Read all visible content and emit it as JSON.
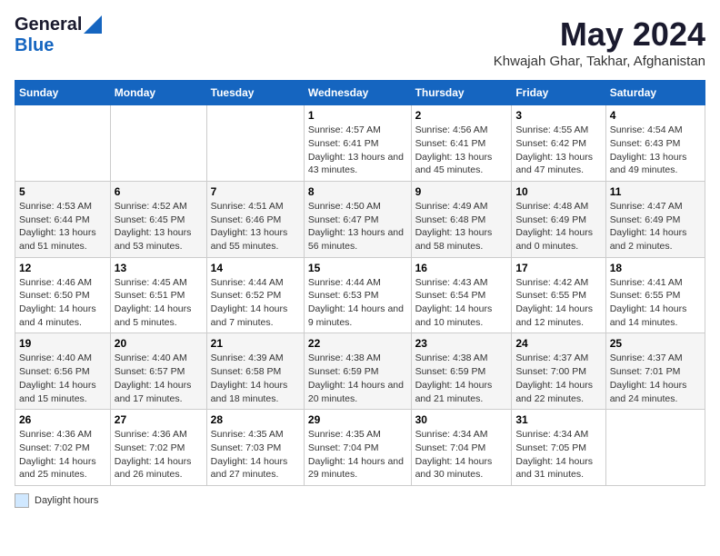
{
  "logo": {
    "general": "General",
    "blue": "Blue"
  },
  "title": "May 2024",
  "subtitle": "Khwajah Ghar, Takhar, Afghanistan",
  "headers": [
    "Sunday",
    "Monday",
    "Tuesday",
    "Wednesday",
    "Thursday",
    "Friday",
    "Saturday"
  ],
  "weeks": [
    [
      {
        "day": "",
        "sunrise": "",
        "sunset": "",
        "daylight": ""
      },
      {
        "day": "",
        "sunrise": "",
        "sunset": "",
        "daylight": ""
      },
      {
        "day": "",
        "sunrise": "",
        "sunset": "",
        "daylight": ""
      },
      {
        "day": "1",
        "sunrise": "Sunrise: 4:57 AM",
        "sunset": "Sunset: 6:41 PM",
        "daylight": "Daylight: 13 hours and 43 minutes."
      },
      {
        "day": "2",
        "sunrise": "Sunrise: 4:56 AM",
        "sunset": "Sunset: 6:41 PM",
        "daylight": "Daylight: 13 hours and 45 minutes."
      },
      {
        "day": "3",
        "sunrise": "Sunrise: 4:55 AM",
        "sunset": "Sunset: 6:42 PM",
        "daylight": "Daylight: 13 hours and 47 minutes."
      },
      {
        "day": "4",
        "sunrise": "Sunrise: 4:54 AM",
        "sunset": "Sunset: 6:43 PM",
        "daylight": "Daylight: 13 hours and 49 minutes."
      }
    ],
    [
      {
        "day": "5",
        "sunrise": "Sunrise: 4:53 AM",
        "sunset": "Sunset: 6:44 PM",
        "daylight": "Daylight: 13 hours and 51 minutes."
      },
      {
        "day": "6",
        "sunrise": "Sunrise: 4:52 AM",
        "sunset": "Sunset: 6:45 PM",
        "daylight": "Daylight: 13 hours and 53 minutes."
      },
      {
        "day": "7",
        "sunrise": "Sunrise: 4:51 AM",
        "sunset": "Sunset: 6:46 PM",
        "daylight": "Daylight: 13 hours and 55 minutes."
      },
      {
        "day": "8",
        "sunrise": "Sunrise: 4:50 AM",
        "sunset": "Sunset: 6:47 PM",
        "daylight": "Daylight: 13 hours and 56 minutes."
      },
      {
        "day": "9",
        "sunrise": "Sunrise: 4:49 AM",
        "sunset": "Sunset: 6:48 PM",
        "daylight": "Daylight: 13 hours and 58 minutes."
      },
      {
        "day": "10",
        "sunrise": "Sunrise: 4:48 AM",
        "sunset": "Sunset: 6:49 PM",
        "daylight": "Daylight: 14 hours and 0 minutes."
      },
      {
        "day": "11",
        "sunrise": "Sunrise: 4:47 AM",
        "sunset": "Sunset: 6:49 PM",
        "daylight": "Daylight: 14 hours and 2 minutes."
      }
    ],
    [
      {
        "day": "12",
        "sunrise": "Sunrise: 4:46 AM",
        "sunset": "Sunset: 6:50 PM",
        "daylight": "Daylight: 14 hours and 4 minutes."
      },
      {
        "day": "13",
        "sunrise": "Sunrise: 4:45 AM",
        "sunset": "Sunset: 6:51 PM",
        "daylight": "Daylight: 14 hours and 5 minutes."
      },
      {
        "day": "14",
        "sunrise": "Sunrise: 4:44 AM",
        "sunset": "Sunset: 6:52 PM",
        "daylight": "Daylight: 14 hours and 7 minutes."
      },
      {
        "day": "15",
        "sunrise": "Sunrise: 4:44 AM",
        "sunset": "Sunset: 6:53 PM",
        "daylight": "Daylight: 14 hours and 9 minutes."
      },
      {
        "day": "16",
        "sunrise": "Sunrise: 4:43 AM",
        "sunset": "Sunset: 6:54 PM",
        "daylight": "Daylight: 14 hours and 10 minutes."
      },
      {
        "day": "17",
        "sunrise": "Sunrise: 4:42 AM",
        "sunset": "Sunset: 6:55 PM",
        "daylight": "Daylight: 14 hours and 12 minutes."
      },
      {
        "day": "18",
        "sunrise": "Sunrise: 4:41 AM",
        "sunset": "Sunset: 6:55 PM",
        "daylight": "Daylight: 14 hours and 14 minutes."
      }
    ],
    [
      {
        "day": "19",
        "sunrise": "Sunrise: 4:40 AM",
        "sunset": "Sunset: 6:56 PM",
        "daylight": "Daylight: 14 hours and 15 minutes."
      },
      {
        "day": "20",
        "sunrise": "Sunrise: 4:40 AM",
        "sunset": "Sunset: 6:57 PM",
        "daylight": "Daylight: 14 hours and 17 minutes."
      },
      {
        "day": "21",
        "sunrise": "Sunrise: 4:39 AM",
        "sunset": "Sunset: 6:58 PM",
        "daylight": "Daylight: 14 hours and 18 minutes."
      },
      {
        "day": "22",
        "sunrise": "Sunrise: 4:38 AM",
        "sunset": "Sunset: 6:59 PM",
        "daylight": "Daylight: 14 hours and 20 minutes."
      },
      {
        "day": "23",
        "sunrise": "Sunrise: 4:38 AM",
        "sunset": "Sunset: 6:59 PM",
        "daylight": "Daylight: 14 hours and 21 minutes."
      },
      {
        "day": "24",
        "sunrise": "Sunrise: 4:37 AM",
        "sunset": "Sunset: 7:00 PM",
        "daylight": "Daylight: 14 hours and 22 minutes."
      },
      {
        "day": "25",
        "sunrise": "Sunrise: 4:37 AM",
        "sunset": "Sunset: 7:01 PM",
        "daylight": "Daylight: 14 hours and 24 minutes."
      }
    ],
    [
      {
        "day": "26",
        "sunrise": "Sunrise: 4:36 AM",
        "sunset": "Sunset: 7:02 PM",
        "daylight": "Daylight: 14 hours and 25 minutes."
      },
      {
        "day": "27",
        "sunrise": "Sunrise: 4:36 AM",
        "sunset": "Sunset: 7:02 PM",
        "daylight": "Daylight: 14 hours and 26 minutes."
      },
      {
        "day": "28",
        "sunrise": "Sunrise: 4:35 AM",
        "sunset": "Sunset: 7:03 PM",
        "daylight": "Daylight: 14 hours and 27 minutes."
      },
      {
        "day": "29",
        "sunrise": "Sunrise: 4:35 AM",
        "sunset": "Sunset: 7:04 PM",
        "daylight": "Daylight: 14 hours and 29 minutes."
      },
      {
        "day": "30",
        "sunrise": "Sunrise: 4:34 AM",
        "sunset": "Sunset: 7:04 PM",
        "daylight": "Daylight: 14 hours and 30 minutes."
      },
      {
        "day": "31",
        "sunrise": "Sunrise: 4:34 AM",
        "sunset": "Sunset: 7:05 PM",
        "daylight": "Daylight: 14 hours and 31 minutes."
      },
      {
        "day": "",
        "sunrise": "",
        "sunset": "",
        "daylight": ""
      }
    ]
  ],
  "legend": {
    "daylight_label": "Daylight hours"
  }
}
